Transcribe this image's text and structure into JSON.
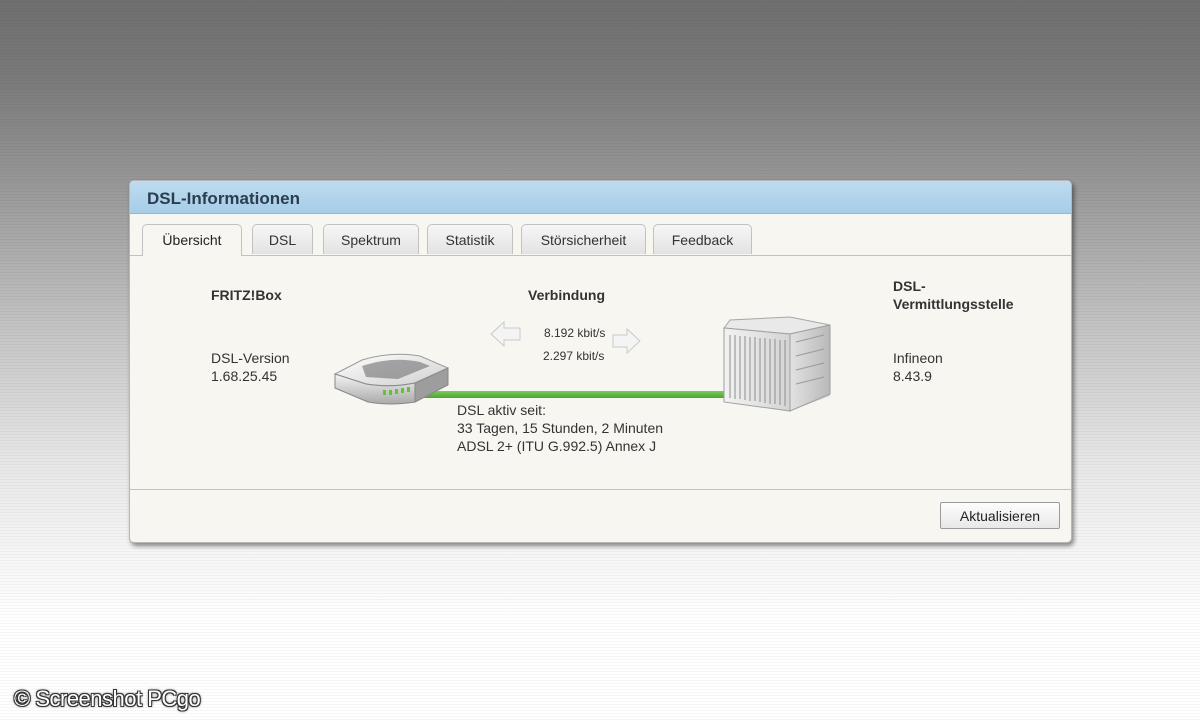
{
  "dialog": {
    "title": "DSL-Informationen"
  },
  "tabs": [
    {
      "label": "Übersicht",
      "active": true
    },
    {
      "label": "DSL",
      "active": false
    },
    {
      "label": "Spektrum",
      "active": false
    },
    {
      "label": "Statistik",
      "active": false
    },
    {
      "label": "Störsicherheit",
      "active": false
    },
    {
      "label": "Feedback",
      "active": false
    }
  ],
  "overview": {
    "fritzbox": {
      "heading": "FRITZ!Box",
      "version_label": "DSL-Version",
      "version_value": "1.68.25.45"
    },
    "connection": {
      "heading": "Verbindung",
      "downstream": "8.192 kbit/s",
      "upstream": "2.297 kbit/s",
      "line_color": "#5cb83f"
    },
    "exchange": {
      "heading_line1": "DSL-",
      "heading_line2": "Vermittlungsstelle",
      "vendor": "Infineon",
      "version": "8.43.9"
    },
    "status": {
      "line1": "DSL aktiv seit:",
      "line2": "33 Tagen, 15 Stunden, 2 Minuten",
      "line3": "ADSL 2+ (ITU G.992.5) Annex J"
    }
  },
  "footer": {
    "refresh_label": "Aktualisieren"
  },
  "watermark": "© Screenshot PCgo",
  "colors": {
    "header_blue": "#a6cde8",
    "panel_bg": "#f8f6f1",
    "dsl_line_green": "#5cb83f"
  }
}
